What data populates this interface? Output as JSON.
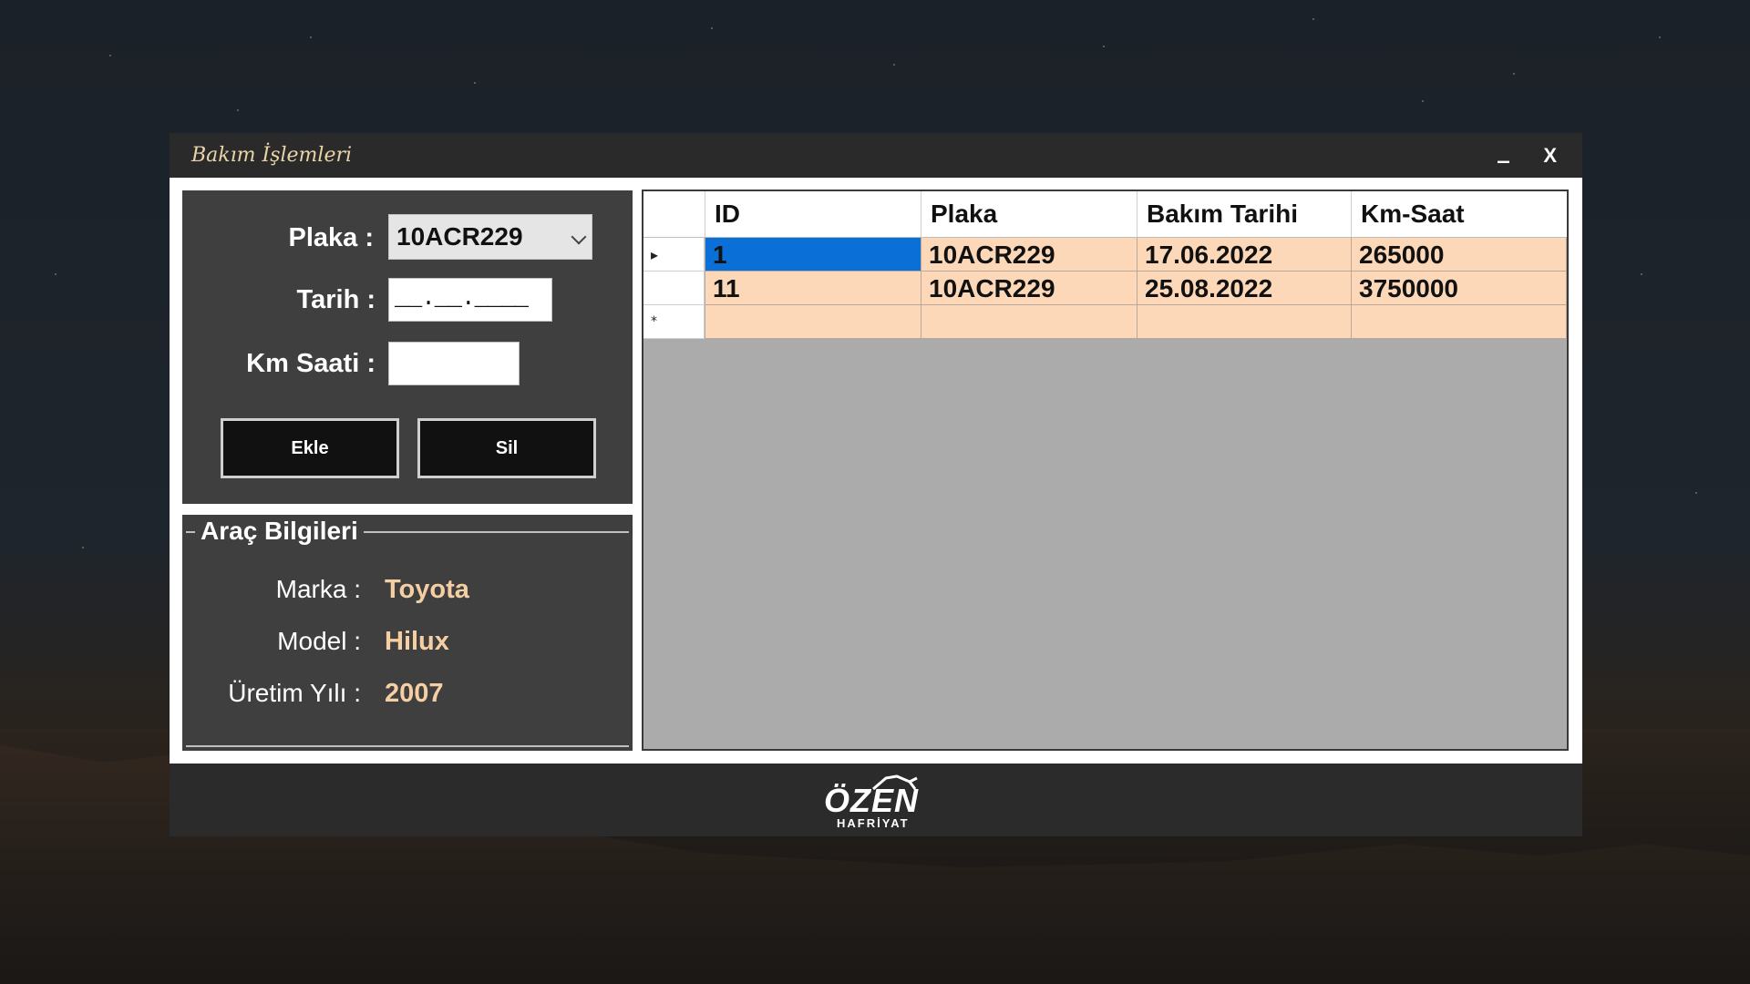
{
  "window": {
    "title": "Bakım İşlemleri",
    "minimize_label": "_",
    "close_label": "X"
  },
  "form": {
    "plaka_label": "Plaka :",
    "plaka_value": "10ACR229",
    "tarih_label": "Tarih :",
    "tarih_mask": "__.__.____",
    "km_label": "Km Saati :",
    "km_value": "",
    "add_button": "Ekle",
    "delete_button": "Sil"
  },
  "vehicle_info": {
    "title": "Araç Bilgileri",
    "marka_label": "Marka :",
    "marka_value": "Toyota",
    "model_label": "Model :",
    "model_value": "Hilux",
    "year_label": "Üretim Yılı :",
    "year_value": "2007"
  },
  "table": {
    "columns": [
      "ID",
      "Plaka",
      "Bakım Tarihi",
      "Km-Saat"
    ],
    "rows": [
      {
        "id": "1",
        "plaka": "10ACR229",
        "tarih": "17.06.2022",
        "km": "265000"
      },
      {
        "id": "11",
        "plaka": "10ACR229",
        "tarih": "25.08.2022",
        "km": "3750000"
      }
    ],
    "current_row_marker": "▸",
    "new_row_marker": "*"
  },
  "footer": {
    "logo_main": "ÖZEN",
    "logo_sub": "HAFRİYAT"
  },
  "colors": {
    "accent": "#f5cfa3",
    "row_bg": "#fdd8b8",
    "selected": "#0a6fd6",
    "panel": "#3f3f3f"
  }
}
